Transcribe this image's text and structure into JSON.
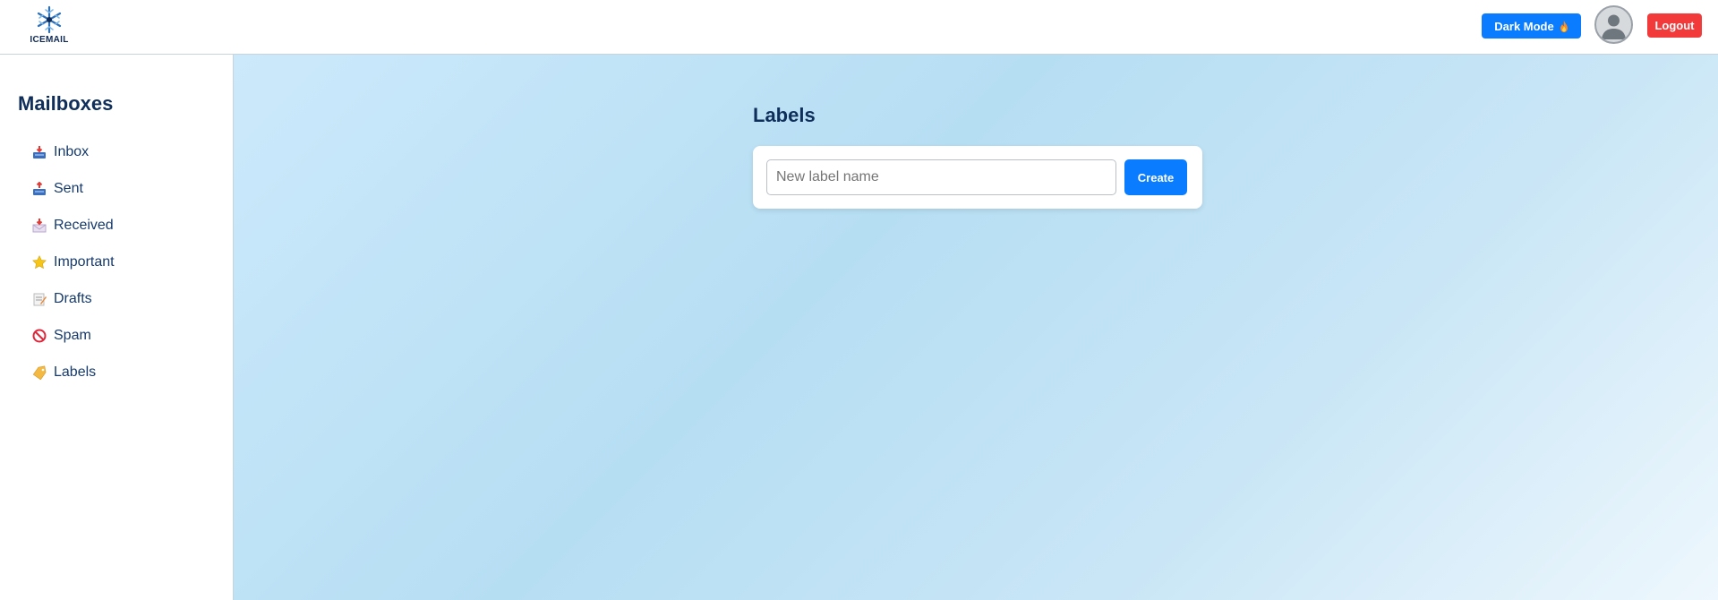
{
  "header": {
    "logo_text": "ICEMAIL",
    "dark_mode_label": "Dark Mode",
    "dark_mode_icon": "fire-icon",
    "logout_label": "Logout"
  },
  "sidebar": {
    "title": "Mailboxes",
    "items": [
      {
        "label": "Inbox",
        "icon": "inbox-tray-icon"
      },
      {
        "label": "Sent",
        "icon": "outbox-tray-icon"
      },
      {
        "label": "Received",
        "icon": "incoming-envelope-icon"
      },
      {
        "label": "Important",
        "icon": "star-icon"
      },
      {
        "label": "Drafts",
        "icon": "memo-icon"
      },
      {
        "label": "Spam",
        "icon": "prohibited-icon"
      },
      {
        "label": "Labels",
        "icon": "label-tag-icon"
      }
    ]
  },
  "main": {
    "title": "Labels",
    "new_label_placeholder": "New label name",
    "new_label_value": "",
    "create_label": "Create"
  },
  "colors": {
    "accent": "#0a7cff",
    "danger": "#f23a3a",
    "heading": "#0f2e5a"
  }
}
